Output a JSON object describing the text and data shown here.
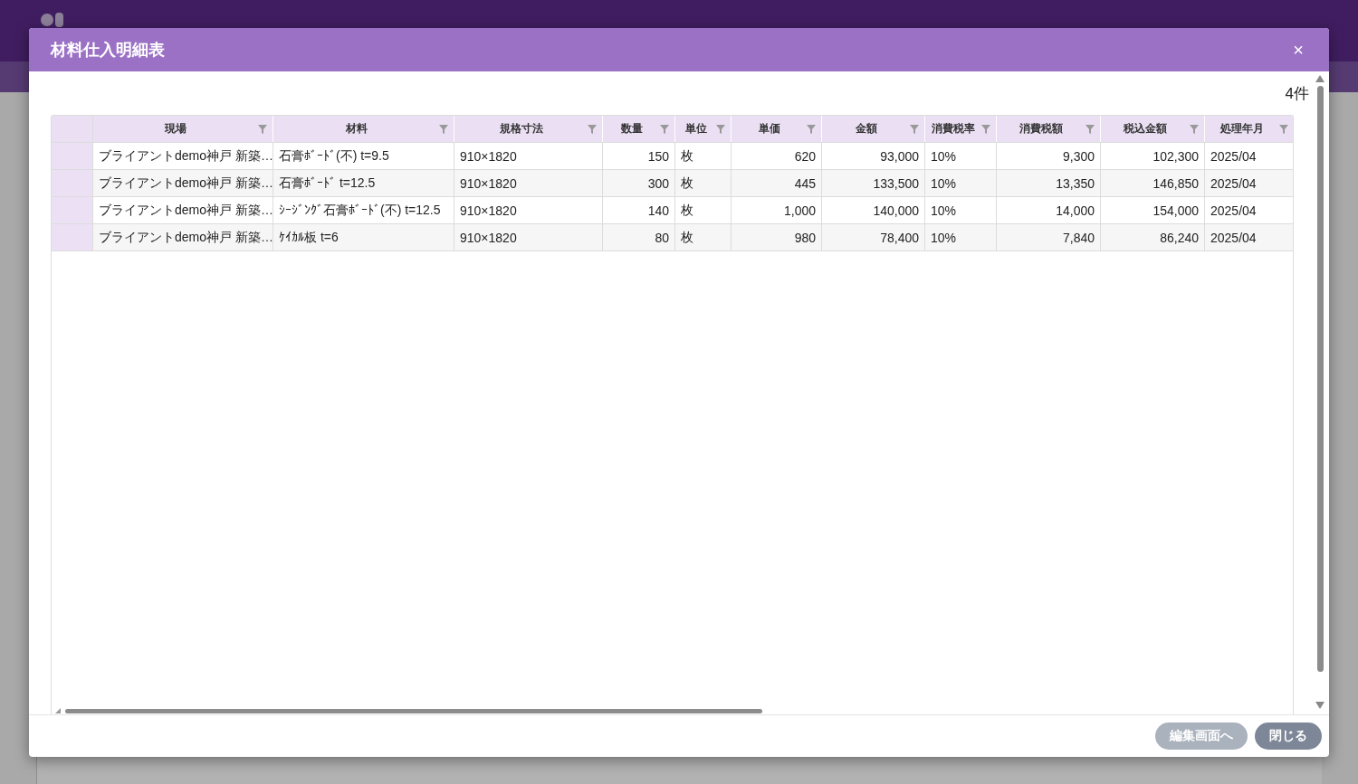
{
  "dialog": {
    "title": "材料仕入明細表",
    "close": "×",
    "count": "4件",
    "table": {
      "columns": [
        {
          "label": "現場",
          "kind": "text"
        },
        {
          "label": "材料",
          "kind": "text"
        },
        {
          "label": "規格寸法",
          "kind": "text"
        },
        {
          "label": "数量",
          "kind": "number"
        },
        {
          "label": "単位",
          "kind": "text"
        },
        {
          "label": "単価",
          "kind": "number"
        },
        {
          "label": "金額",
          "kind": "number"
        },
        {
          "label": "消費税率",
          "kind": "text"
        },
        {
          "label": "消費税額",
          "kind": "number"
        },
        {
          "label": "税込金額",
          "kind": "number"
        },
        {
          "label": "処理年月",
          "kind": "text"
        }
      ],
      "rows": [
        {
          "cells": [
            "ブライアントdemo神戸 新築…",
            "石膏ﾎﾞｰﾄﾞ(不) t=9.5",
            "910×1820",
            "150",
            "枚",
            "620",
            "93,000",
            "10%",
            "9,300",
            "102,300",
            "2025/04"
          ]
        },
        {
          "cells": [
            "ブライアントdemo神戸 新築…",
            "石膏ﾎﾞｰﾄﾞ t=12.5",
            "910×1820",
            "300",
            "枚",
            "445",
            "133,500",
            "10%",
            "13,350",
            "146,850",
            "2025/04"
          ]
        },
        {
          "cells": [
            "ブライアントdemo神戸 新築…",
            "ｼｰｼﾞﾝｸﾞ石膏ﾎﾞｰﾄﾞ(不) t=12.5",
            "910×1820",
            "140",
            "枚",
            "1,000",
            "140,000",
            "10%",
            "14,000",
            "154,000",
            "2025/04"
          ]
        },
        {
          "cells": [
            "ブライアントdemo神戸 新築…",
            "ｹｲｶﾙ板 t=6",
            "910×1820",
            "80",
            "枚",
            "980",
            "78,400",
            "10%",
            "7,840",
            "86,240",
            "2025/04"
          ]
        }
      ]
    },
    "buttons": [
      {
        "label": "編集画面へ",
        "disabled": true
      },
      {
        "label": "閉じる",
        "disabled": false
      }
    ]
  }
}
